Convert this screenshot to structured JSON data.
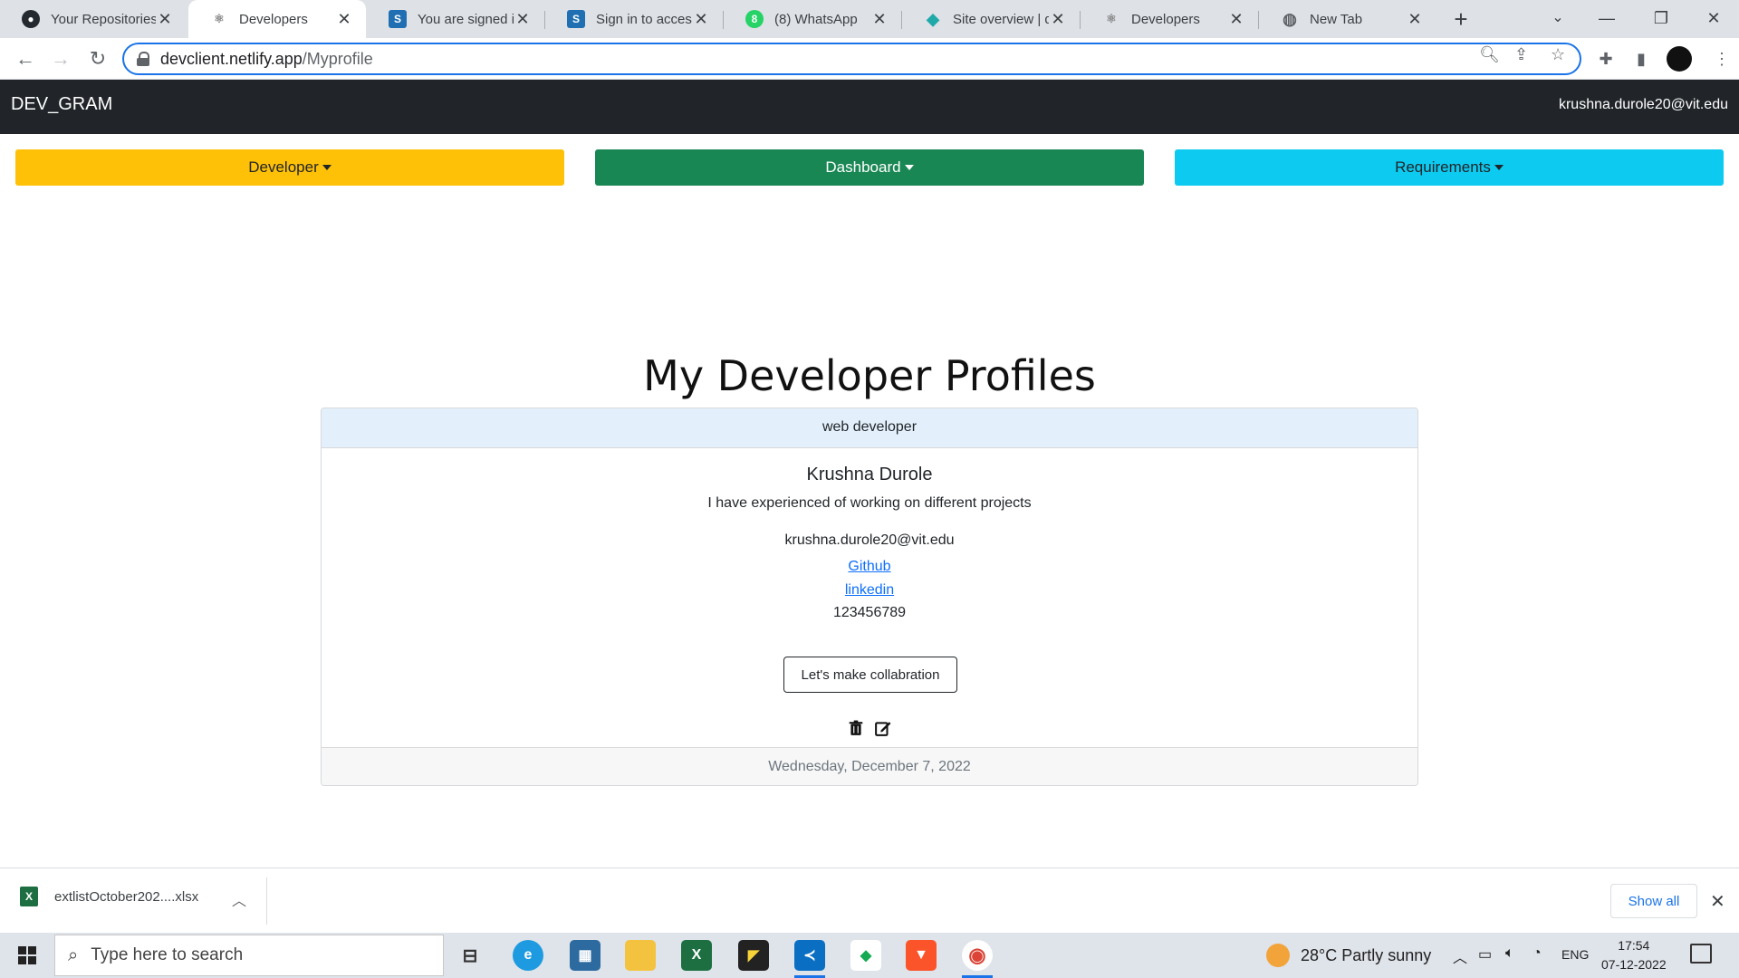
{
  "browser": {
    "tabs": [
      {
        "title": "Your Repositories",
        "icon": "github-icon",
        "active": false
      },
      {
        "title": "Developers",
        "icon": "react-icon",
        "active": true
      },
      {
        "title": "You are signed in",
        "icon": "s-icon",
        "active": false
      },
      {
        "title": "Sign in to access",
        "icon": "s-icon",
        "active": false
      },
      {
        "title": "(8) WhatsApp",
        "icon": "whatsapp-icon",
        "active": false
      },
      {
        "title": "Site overview | de",
        "icon": "netlify-icon",
        "active": false
      },
      {
        "title": "Developers",
        "icon": "react-icon",
        "active": false
      },
      {
        "title": "New Tab",
        "icon": "globe-icon",
        "active": false
      }
    ],
    "url_host": "devclient.netlify.app",
    "url_path": "/Myprofile"
  },
  "app": {
    "brand": "DEV_GRAM",
    "user_email": "krushna.durole20@vit.edu",
    "menus": [
      {
        "label": "Developer",
        "color": "#ffc107",
        "text_color": "#212529"
      },
      {
        "label": "Dashboard",
        "color": "#198754",
        "text_color": "#ffffff"
      },
      {
        "label": "Requirements",
        "color": "#0dcaf0",
        "text_color": "#212529"
      }
    ],
    "heading": "My Developer Profiles",
    "profile": {
      "role": "web developer",
      "name": "Krushna Durole",
      "description": "I have experienced of working on different projects",
      "email": "krushna.durole20@vit.edu",
      "github_label": "Github",
      "linkedin_label": "linkedin",
      "phone": "123456789",
      "collab_label": "Let's make collabration",
      "date": "Wednesday, December 7, 2022"
    }
  },
  "downloads": {
    "file_name": "extlistOctober202....xlsx",
    "show_all_label": "Show all"
  },
  "taskbar": {
    "search_placeholder": "Type here to search",
    "weather": "28°C  Partly sunny",
    "language": "ENG",
    "time": "17:54",
    "date": "07-12-2022"
  }
}
